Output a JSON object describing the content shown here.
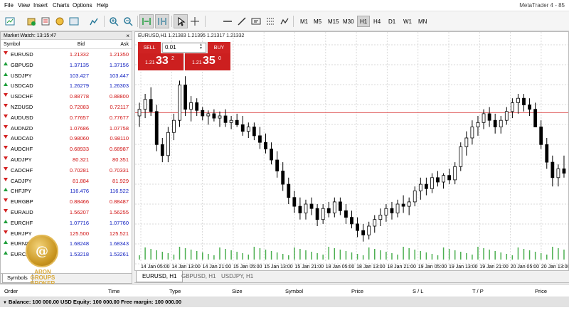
{
  "menu": {
    "items": [
      "File",
      "View",
      "Insert",
      "Charts",
      "Options",
      "Help"
    ],
    "app_title": "MetaTrader 4 - 85"
  },
  "toolbar": {
    "icons": [
      "new-chart",
      "profiles",
      "market-watch",
      "navigator",
      "terminal",
      "zoom-in",
      "zoom-out",
      "tile-windows",
      "auto-scroll",
      "cursor",
      "crosshair",
      "horizontal-line",
      "trendline",
      "text",
      "indicator"
    ],
    "timeframes": [
      "M1",
      "M5",
      "M15",
      "M30",
      "H1",
      "H4",
      "D1",
      "W1",
      "MN"
    ],
    "active_timeframe": "H1"
  },
  "market_watch": {
    "title": "Market Watch: 13:15:47",
    "headers": {
      "symbol": "Symbol",
      "bid": "Bid",
      "ask": "Ask"
    },
    "rows": [
      {
        "symbol": "EURUSD",
        "bid": "1.21332",
        "ask": "1.21350",
        "dir": "down",
        "color": "red"
      },
      {
        "symbol": "GBPUSD",
        "bid": "1.37135",
        "ask": "1.37156",
        "dir": "up",
        "color": "blue"
      },
      {
        "symbol": "USDJPY",
        "bid": "103.427",
        "ask": "103.447",
        "dir": "up",
        "color": "blue"
      },
      {
        "symbol": "USDCAD",
        "bid": "1.26279",
        "ask": "1.26303",
        "dir": "up",
        "color": "blue"
      },
      {
        "symbol": "USDCHF",
        "bid": "0.88778",
        "ask": "0.88800",
        "dir": "down",
        "color": "red"
      },
      {
        "symbol": "NZDUSD",
        "bid": "0.72083",
        "ask": "0.72117",
        "dir": "down",
        "color": "red"
      },
      {
        "symbol": "AUDUSD",
        "bid": "0.77657",
        "ask": "0.77677",
        "dir": "down",
        "color": "red"
      },
      {
        "symbol": "AUDNZD",
        "bid": "1.07686",
        "ask": "1.07758",
        "dir": "down",
        "color": "red"
      },
      {
        "symbol": "AUDCAD",
        "bid": "0.98060",
        "ask": "0.98110",
        "dir": "down",
        "color": "red"
      },
      {
        "symbol": "AUDCHF",
        "bid": "0.68933",
        "ask": "0.68987",
        "dir": "down",
        "color": "red"
      },
      {
        "symbol": "AUDJPY",
        "bid": "80.321",
        "ask": "80.351",
        "dir": "down",
        "color": "red"
      },
      {
        "symbol": "CADCHF",
        "bid": "0.70281",
        "ask": "0.70331",
        "dir": "down",
        "color": "red"
      },
      {
        "symbol": "CADJPY",
        "bid": "81.884",
        "ask": "81.929",
        "dir": "down",
        "color": "red"
      },
      {
        "symbol": "CHFJPY",
        "bid": "116.476",
        "ask": "116.522",
        "dir": "up",
        "color": "blue"
      },
      {
        "symbol": "EURGBP",
        "bid": "0.88466",
        "ask": "0.88487",
        "dir": "down",
        "color": "red"
      },
      {
        "symbol": "EURAUD",
        "bid": "1.56207",
        "ask": "1.56255",
        "dir": "down",
        "color": "red"
      },
      {
        "symbol": "EURCHF",
        "bid": "1.07716",
        "ask": "1.07760",
        "dir": "up",
        "color": "blue"
      },
      {
        "symbol": "EURJPY",
        "bid": "125.500",
        "ask": "125.521",
        "dir": "down",
        "color": "red"
      },
      {
        "symbol": "EURNZD",
        "bid": "1.68248",
        "ask": "1.68343",
        "dir": "up",
        "color": "blue"
      },
      {
        "symbol": "EURCAD",
        "bid": "1.53218",
        "ask": "1.53261",
        "dir": "up",
        "color": "blue"
      }
    ],
    "tab": "Symbols"
  },
  "chart": {
    "info": "EURUSD,H1  1.21383 1.21395 1.21317 1.21332",
    "one_click": {
      "sell_label": "SELL",
      "buy_label": "BUY",
      "lot": "0.01",
      "sell_pre": "1.21",
      "sell_big": "33",
      "sell_sup": "2",
      "buy_pre": "1.21",
      "buy_big": "35",
      "buy_sup": "0"
    },
    "tabs": [
      "EURUSD, H1",
      "GBPUSD, H1",
      "USDJPY, H1"
    ],
    "active_tab": "EURUSD, H1",
    "colors": {
      "bid_line": "#e06060",
      "volume": "#4caf50",
      "candle": "#000000"
    }
  },
  "chart_data": {
    "type": "candlestick",
    "symbol": "EURUSD",
    "timeframe": "H1",
    "x_labels": [
      "14 Jan 05:00",
      "14 Jan 13:00",
      "14 Jan 21:00",
      "15 Jan 05:00",
      "15 Jan 13:00",
      "15 Jan 21:00",
      "18 Jan 05:00",
      "18 Jan 13:00",
      "18 Jan 21:00",
      "19 Jan 05:00",
      "19 Jan 13:00",
      "19 Jan 21:00",
      "20 Jan 05:00",
      "20 Jan 13:00"
    ],
    "candles": [
      [
        1.216,
        1.2172,
        1.215,
        1.2166
      ],
      [
        1.2166,
        1.218,
        1.2158,
        1.2175
      ],
      [
        1.2175,
        1.2186,
        1.216,
        1.2164
      ],
      [
        1.2164,
        1.217,
        1.2128,
        1.2134
      ],
      [
        1.2134,
        1.214,
        1.2118,
        1.2124
      ],
      [
        1.2124,
        1.215,
        1.2118,
        1.2145
      ],
      [
        1.2145,
        1.2162,
        1.2138,
        1.2156
      ],
      [
        1.2156,
        1.2192,
        1.215,
        1.2188
      ],
      [
        1.2188,
        1.2196,
        1.216,
        1.2166
      ],
      [
        1.2166,
        1.2178,
        1.2155,
        1.2172
      ],
      [
        1.2172,
        1.2176,
        1.216,
        1.2165
      ],
      [
        1.2165,
        1.2168,
        1.2156,
        1.216
      ],
      [
        1.216,
        1.2165,
        1.2152,
        1.2162
      ],
      [
        1.2162,
        1.2166,
        1.2155,
        1.2158
      ],
      [
        1.2158,
        1.2164,
        1.215,
        1.216
      ],
      [
        1.216,
        1.2166,
        1.215,
        1.2154
      ],
      [
        1.2154,
        1.216,
        1.2148,
        1.2156
      ],
      [
        1.2156,
        1.2162,
        1.215,
        1.2152
      ],
      [
        1.2152,
        1.216,
        1.2142,
        1.2146
      ],
      [
        1.2146,
        1.2154,
        1.214,
        1.215
      ],
      [
        1.215,
        1.2154,
        1.2138,
        1.2142
      ],
      [
        1.2142,
        1.215,
        1.213,
        1.2136
      ],
      [
        1.2136,
        1.2144,
        1.2126,
        1.213
      ],
      [
        1.213,
        1.2136,
        1.2116,
        1.212
      ],
      [
        1.212,
        1.2128,
        1.2104,
        1.211
      ],
      [
        1.211,
        1.2118,
        1.2092,
        1.2098
      ],
      [
        1.2098,
        1.2104,
        1.208,
        1.2086
      ],
      [
        1.2086,
        1.2092,
        1.2072,
        1.2078
      ],
      [
        1.2078,
        1.2086,
        1.2066,
        1.2072
      ],
      [
        1.2072,
        1.2084,
        1.2066,
        1.208
      ],
      [
        1.208,
        1.2086,
        1.207,
        1.2076
      ],
      [
        1.2076,
        1.208,
        1.206,
        1.2066
      ],
      [
        1.2066,
        1.208,
        1.2062,
        1.2076
      ],
      [
        1.2076,
        1.2082,
        1.2068,
        1.2072
      ],
      [
        1.2072,
        1.2086,
        1.2068,
        1.2082
      ],
      [
        1.2082,
        1.2086,
        1.207,
        1.2074
      ],
      [
        1.2074,
        1.208,
        1.2062,
        1.2068
      ],
      [
        1.2068,
        1.2074,
        1.2058,
        1.2062
      ],
      [
        1.2062,
        1.2068,
        1.205,
        1.2056
      ],
      [
        1.2056,
        1.2062,
        1.2046,
        1.2052
      ],
      [
        1.2052,
        1.2064,
        1.2048,
        1.206
      ],
      [
        1.206,
        1.207,
        1.2054,
        1.2066
      ],
      [
        1.2066,
        1.2076,
        1.206,
        1.207
      ],
      [
        1.207,
        1.208,
        1.2064,
        1.2076
      ],
      [
        1.2076,
        1.2082,
        1.2066,
        1.2072
      ],
      [
        1.2072,
        1.2084,
        1.2068,
        1.208
      ],
      [
        1.208,
        1.2088,
        1.2072,
        1.2078
      ],
      [
        1.2078,
        1.2086,
        1.207,
        1.2082
      ],
      [
        1.2082,
        1.2096,
        1.2078,
        1.2092
      ],
      [
        1.2092,
        1.2104,
        1.2084,
        1.2098
      ],
      [
        1.2098,
        1.2104,
        1.2088,
        1.2094
      ],
      [
        1.2094,
        1.2108,
        1.209,
        1.2104
      ],
      [
        1.2104,
        1.211,
        1.2096,
        1.21
      ],
      [
        1.21,
        1.2108,
        1.2094,
        1.2106
      ],
      [
        1.2106,
        1.2112,
        1.2098,
        1.2102
      ],
      [
        1.2102,
        1.2118,
        1.2098,
        1.2114
      ],
      [
        1.2114,
        1.2136,
        1.211,
        1.2132
      ],
      [
        1.2132,
        1.2146,
        1.2124,
        1.214
      ],
      [
        1.214,
        1.2156,
        1.2134,
        1.215
      ],
      [
        1.215,
        1.216,
        1.2142,
        1.2154
      ],
      [
        1.2154,
        1.2166,
        1.2148,
        1.2162
      ],
      [
        1.2162,
        1.2168,
        1.215,
        1.2156
      ],
      [
        1.2156,
        1.2162,
        1.2144,
        1.215
      ],
      [
        1.215,
        1.216,
        1.2144,
        1.2156
      ],
      [
        1.2156,
        1.2168,
        1.2152,
        1.2164
      ],
      [
        1.2164,
        1.2176,
        1.2158,
        1.2172
      ],
      [
        1.2172,
        1.218,
        1.2162,
        1.2176
      ],
      [
        1.2176,
        1.218,
        1.2164,
        1.217
      ],
      [
        1.217,
        1.2176,
        1.216,
        1.2166
      ],
      [
        1.2166,
        1.2172,
        1.2156,
        1.215
      ],
      [
        1.215,
        1.2156,
        1.213,
        1.2134
      ],
      [
        1.2134,
        1.214,
        1.2112,
        1.2118
      ],
      [
        1.2118,
        1.2124,
        1.2096,
        1.2104
      ],
      [
        1.2104,
        1.2116,
        1.2096,
        1.2112
      ],
      [
        1.2112,
        1.2124,
        1.2104,
        1.2108
      ]
    ],
    "bid_line": 1.2163,
    "ylim": [
      1.204,
      1.22
    ]
  },
  "terminal": {
    "headers": [
      "Order",
      "Time",
      "Type",
      "Size",
      "Symbol",
      "Price",
      "S / L",
      "T / P",
      "Price"
    ],
    "balance": "Balance: 100 000.00 USD  Equity: 100 000.00  Free margin: 100 000.00"
  },
  "logo": {
    "text_line1": "ARON",
    "text_line2": "GROUPS",
    "text_line3": "BROKER"
  }
}
